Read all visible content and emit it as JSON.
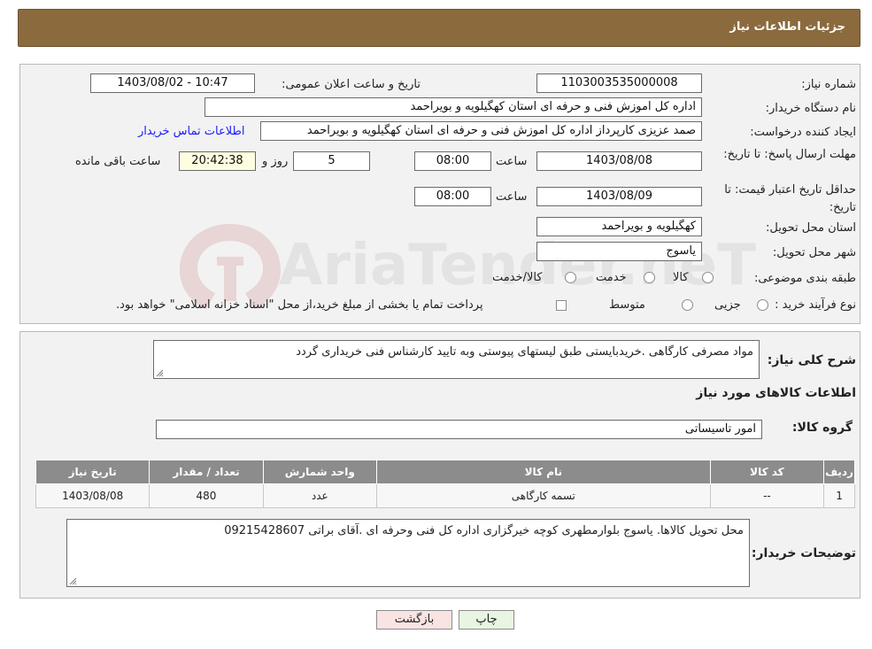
{
  "header": {
    "title": "جزئیات اطلاعات نیاز"
  },
  "form": {
    "need_number_label": "شماره نیاز:",
    "need_number": "1103003535000008",
    "announce_label": "تاریخ و ساعت اعلان عمومی:",
    "announce_value": "1403/08/02 - 10:47",
    "buyer_org_label": "نام دستگاه خریدار:",
    "buyer_org": "اداره کل اموزش فنی و حرفه ای استان کهگیلویه و بویراحمد",
    "creator_label": "ایجاد کننده درخواست:",
    "creator": "صمد عزیزی کارپرداز اداره کل اموزش فنی و حرفه ای استان کهگیلویه و بویراحمد",
    "contact_link": "اطلاعات تماس خریدار",
    "deadline_label": "مهلت ارسال پاسخ: تا تاریخ:",
    "deadline_date": "1403/08/08",
    "time_label": "ساعت",
    "deadline_time": "08:00",
    "days_value": "5",
    "days_label": "روز و",
    "remaining_time": "20:42:38",
    "remaining_label": "ساعت باقی مانده",
    "validity_label": "حداقل تاریخ اعتبار قیمت: تا تاریخ:",
    "validity_date": "1403/08/09",
    "validity_time": "08:00",
    "province_label": "استان محل تحویل:",
    "province": "کهگیلویه و بویراحمد",
    "city_label": "شهر محل تحویل:",
    "city": "یاسوج",
    "category_label": "طبقه بندی موضوعی:",
    "category_options": [
      "کالا",
      "خدمت",
      "کالا/خدمت"
    ],
    "process_label": "نوع فرآیند خرید :",
    "process_options": [
      "جزیی",
      "متوسط"
    ],
    "process_note": "پرداخت تمام یا بخشی از مبلغ خرید،از محل \"اسناد خزانه اسلامی\" خواهد بود."
  },
  "summary": {
    "label": "شرح کلی نیاز:",
    "text": "مواد مصرفی کارگاهی  .خریدبایستی  طبق لیستهای پیوستی وبه تایید کارشناس فنی خریداری گردد",
    "items_title": "اطلاعات کالاهای مورد نیاز",
    "group_label": "گروه کالا:",
    "group_value": "امور تاسیساتی"
  },
  "table": {
    "headers": [
      "ردیف",
      "کد کالا",
      "نام کالا",
      "واحد شمارش",
      "تعداد / مقدار",
      "تاریخ نیاز"
    ],
    "rows": [
      [
        "1",
        "--",
        "تسمه کارگاهی",
        "عدد",
        "480",
        "1403/08/08"
      ]
    ]
  },
  "buyer_notes": {
    "label": "توضیحات خریدار:",
    "text": "محل تحویل کالاها. یاسوج بلوارمطهری کوچه خیرگزاری اداره کل فنی وحرفه ای .آقای براتی 09215428607"
  },
  "buttons": {
    "print": "چاپ",
    "back": "بازگشت"
  },
  "watermark": {
    "text": "AriaTender.neT"
  },
  "colors": {
    "header_bg": "#8b6a3e",
    "link": "#1a1aff",
    "table_header": "#8c8c8c",
    "print_btn": "#e8f5e1",
    "back_btn": "#f9e3e3"
  }
}
